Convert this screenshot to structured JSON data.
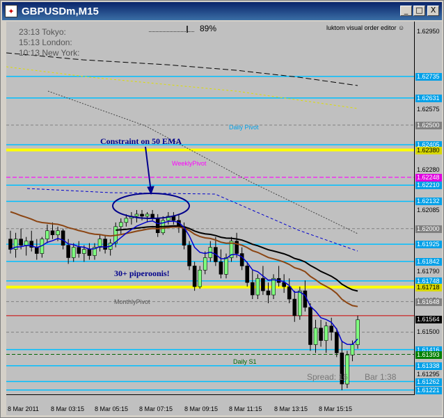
{
  "window": {
    "title": "GBPUSDm,M15",
    "minimize_label": "_",
    "restore_label": "□",
    "close_label": "X"
  },
  "overlay": {
    "sessions": [
      {
        "time": "23:13",
        "city": "Tokyo:"
      },
      {
        "time": "15:13",
        "city": "London:"
      },
      {
        "time": "10:13",
        "city": "New York:"
      }
    ],
    "percent": "89%",
    "indicator_name": "luktom visual order editor ☺",
    "spread": "Spread: 16",
    "bar_timer": "Bar   1:38"
  },
  "annotations": {
    "constraint": "Constraint on 50 EMA",
    "piperoonis": "30+ piperoonis!"
  },
  "levels": {
    "daily_pivot": "Daily Pivot",
    "weekly_pivot": "WeeklyPivot",
    "monthly_pivot": "MonthlyPivot",
    "daily_s1": "Daily S1"
  },
  "price_axis": {
    "plain_ticks": [
      "1.62950",
      "1.62575",
      "1.62280",
      "1.62085",
      "1.61790",
      "1.61650",
      "1.61500",
      "1.61295"
    ],
    "boxed_ticks": [
      {
        "label": "1.62735",
        "color": "#00a0e8"
      },
      {
        "label": "1.62631",
        "color": "#00a0e8"
      },
      {
        "label": "1.62500",
        "color": "#808080"
      },
      {
        "label": "1.62405",
        "color": "#00a0e8"
      },
      {
        "label": "1.62380",
        "color": "#d8d800"
      },
      {
        "label": "1.62248",
        "color": "#e000e0"
      },
      {
        "label": "1.62210",
        "color": "#00a0e8"
      },
      {
        "label": "1.62132",
        "color": "#00a0e8"
      },
      {
        "label": "1.62000",
        "color": "#808080"
      },
      {
        "label": "1.61925",
        "color": "#00a0e8"
      },
      {
        "label": "1.61842",
        "color": "#00a0e8"
      },
      {
        "label": "1.61748",
        "color": "#00a0e8"
      },
      {
        "label": "1.61718",
        "color": "#d8d800"
      },
      {
        "label": "1.61648",
        "color": "#808080"
      },
      {
        "label": "1.61564",
        "color": "#000000"
      },
      {
        "label": "1.61416",
        "color": "#00a0e8"
      },
      {
        "label": "1.61393",
        "color": "#008000"
      },
      {
        "label": "1.61338",
        "color": "#00a0e8"
      },
      {
        "label": "1.61262",
        "color": "#00a0e8"
      },
      {
        "label": "1.61221",
        "color": "#00a0e8"
      }
    ]
  },
  "time_axis": [
    "8 Mar 2011",
    "8 Mar 03:15",
    "8 Mar 05:15",
    "8 Mar 07:15",
    "8 Mar 09:15",
    "8 Mar 11:15",
    "8 Mar 13:15",
    "8 Mar 15:15"
  ],
  "colors": {
    "background": "#c0c0c0",
    "pivot_yellow": "#ffff00",
    "level_cyan": "#00bfff",
    "weekly_magenta": "#ff00ff",
    "bull_candle": "#7fff7f",
    "bear_candle": "#000000",
    "ema_fast": "#0000cc",
    "ema_50": "#8b4513",
    "ema_slow": "#000000",
    "annotation_navy": "#00008b"
  },
  "chart_data": {
    "type": "candlestick",
    "symbol": "GBPUSDm",
    "timeframe": "M15",
    "y_range": [
      1.612,
      1.63
    ],
    "x_labels": [
      "8 Mar 2011",
      "8 Mar 03:15",
      "8 Mar 05:15",
      "8 Mar 07:15",
      "8 Mar 09:15",
      "8 Mar 11:15",
      "8 Mar 13:15",
      "8 Mar 15:15"
    ],
    "candles": [
      [
        1.6195,
        1.6199,
        1.6188,
        1.619
      ],
      [
        1.619,
        1.6198,
        1.6186,
        1.6195
      ],
      [
        1.6195,
        1.62,
        1.619,
        1.6192
      ],
      [
        1.6192,
        1.6196,
        1.6187,
        1.6194
      ],
      [
        1.6194,
        1.6199,
        1.6189,
        1.6191
      ],
      [
        1.6191,
        1.6195,
        1.6185,
        1.6188
      ],
      [
        1.6188,
        1.6196,
        1.6186,
        1.6195
      ],
      [
        1.6195,
        1.6202,
        1.6193,
        1.6199
      ],
      [
        1.6199,
        1.6203,
        1.6195,
        1.6197
      ],
      [
        1.6197,
        1.6201,
        1.6194,
        1.6199
      ],
      [
        1.6199,
        1.62,
        1.619,
        1.6192
      ],
      [
        1.6192,
        1.6195,
        1.6183,
        1.6186
      ],
      [
        1.6186,
        1.6193,
        1.6184,
        1.6191
      ],
      [
        1.6191,
        1.6194,
        1.6186,
        1.6188
      ],
      [
        1.6188,
        1.6192,
        1.6184,
        1.619
      ],
      [
        1.619,
        1.6193,
        1.6185,
        1.6187
      ],
      [
        1.6187,
        1.6193,
        1.6185,
        1.6191
      ],
      [
        1.6191,
        1.6197,
        1.6189,
        1.6195
      ],
      [
        1.6195,
        1.6197,
        1.6188,
        1.619
      ],
      [
        1.619,
        1.6195,
        1.6187,
        1.6193
      ],
      [
        1.6193,
        1.6203,
        1.6191,
        1.6201
      ],
      [
        1.6201,
        1.6205,
        1.6197,
        1.6203
      ],
      [
        1.6203,
        1.6207,
        1.6201,
        1.6205
      ],
      [
        1.6205,
        1.6208,
        1.6202,
        1.6206
      ],
      [
        1.6206,
        1.6209,
        1.6203,
        1.6207
      ],
      [
        1.6207,
        1.6209,
        1.6204,
        1.6206
      ],
      [
        1.6206,
        1.6208,
        1.6203,
        1.6207
      ],
      [
        1.6207,
        1.6209,
        1.6204,
        1.6205
      ],
      [
        1.6205,
        1.6207,
        1.6196,
        1.6198
      ],
      [
        1.6198,
        1.6206,
        1.6197,
        1.6204
      ],
      [
        1.6204,
        1.6208,
        1.6202,
        1.6206
      ],
      [
        1.6206,
        1.6208,
        1.6202,
        1.6204
      ],
      [
        1.6204,
        1.6207,
        1.6198,
        1.6201
      ],
      [
        1.6201,
        1.6203,
        1.619,
        1.6192
      ],
      [
        1.6192,
        1.6194,
        1.618,
        1.6182
      ],
      [
        1.6182,
        1.6184,
        1.617,
        1.6172
      ],
      [
        1.6172,
        1.6182,
        1.6171,
        1.618
      ],
      [
        1.618,
        1.6189,
        1.6178,
        1.6186
      ],
      [
        1.6186,
        1.6194,
        1.6184,
        1.6191
      ],
      [
        1.6191,
        1.6196,
        1.6182,
        1.6184
      ],
      [
        1.6184,
        1.619,
        1.6176,
        1.6178
      ],
      [
        1.6178,
        1.6188,
        1.6176,
        1.6186
      ],
      [
        1.6186,
        1.6196,
        1.6184,
        1.6194
      ],
      [
        1.6194,
        1.6198,
        1.6186,
        1.6188
      ],
      [
        1.6188,
        1.6191,
        1.618,
        1.6182
      ],
      [
        1.6182,
        1.6184,
        1.6172,
        1.6174
      ],
      [
        1.6174,
        1.618,
        1.6166,
        1.6168
      ],
      [
        1.6168,
        1.6178,
        1.6166,
        1.6176
      ],
      [
        1.6176,
        1.6182,
        1.6168,
        1.617
      ],
      [
        1.617,
        1.6174,
        1.6164,
        1.6168
      ],
      [
        1.6168,
        1.6178,
        1.6166,
        1.6176
      ],
      [
        1.6176,
        1.6182,
        1.6172,
        1.6174
      ],
      [
        1.6174,
        1.6178,
        1.6169,
        1.6172
      ],
      [
        1.6172,
        1.6176,
        1.6164,
        1.6166
      ],
      [
        1.6166,
        1.617,
        1.6155,
        1.6158
      ],
      [
        1.6158,
        1.6172,
        1.6156,
        1.617
      ],
      [
        1.617,
        1.6175,
        1.616,
        1.6162
      ],
      [
        1.6162,
        1.6164,
        1.6141,
        1.6144
      ],
      [
        1.6144,
        1.6156,
        1.614,
        1.6152
      ],
      [
        1.6152,
        1.6156,
        1.6143,
        1.6146
      ],
      [
        1.6146,
        1.6155,
        1.614,
        1.6153
      ],
      [
        1.6153,
        1.6157,
        1.6146,
        1.615
      ],
      [
        1.615,
        1.6152,
        1.6138,
        1.614
      ],
      [
        1.614,
        1.6146,
        1.6122,
        1.6125
      ],
      [
        1.6125,
        1.6141,
        1.6123,
        1.6139
      ],
      [
        1.6139,
        1.6146,
        1.6136,
        1.6144
      ],
      [
        1.6144,
        1.6158,
        1.6142,
        1.6156
      ]
    ],
    "levels": [
      {
        "name": "Daily Pivot",
        "value": 1.6238
      },
      {
        "name": "WeeklyPivot",
        "value": 1.62248
      },
      {
        "name": "MonthlyPivot",
        "value": 1.61648
      },
      {
        "name": "Daily S1",
        "value": 1.61393
      }
    ]
  }
}
